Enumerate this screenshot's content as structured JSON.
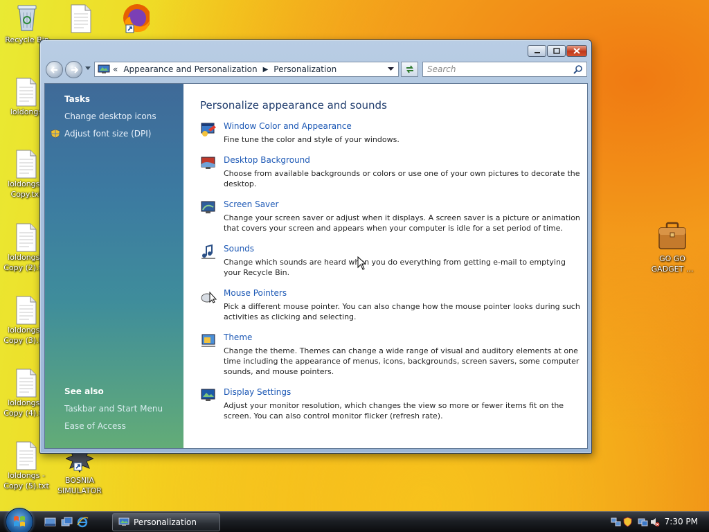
{
  "desktop": {
    "icons": [
      {
        "label": "Recycle Bin"
      },
      {
        "label": ""
      },
      {
        "label": ""
      },
      {
        "label": "loldongs"
      },
      {
        "label": "loldongs -\nCopy.txt"
      },
      {
        "label": "loldongs -\nCopy (2).txt"
      },
      {
        "label": "loldongs -\nCopy (3).txt"
      },
      {
        "label": "loldongs -\nCopy (4).txt"
      },
      {
        "label": "loldongs -\nCopy (5).txt"
      },
      {
        "label": "BOSNIA\nSIMULATOR"
      },
      {
        "label": "GO GO\nGADGET ..."
      }
    ]
  },
  "window": {
    "address": {
      "crumbs": [
        "Appearance and Personalization",
        "Personalization"
      ],
      "overflow_chevron": "«",
      "separator": "▶"
    },
    "search": {
      "placeholder": "Search"
    },
    "sidebar": {
      "tasks_heading": "Tasks",
      "tasks": [
        "Change desktop icons",
        "Adjust font size (DPI)"
      ],
      "see_also_heading": "See also",
      "see_also": [
        "Taskbar and Start Menu",
        "Ease of Access"
      ]
    },
    "main": {
      "title": "Personalize appearance and sounds",
      "items": [
        {
          "title": "Window Color and Appearance",
          "desc": "Fine tune the color and style of your windows.",
          "icon": "window-color-icon"
        },
        {
          "title": "Desktop Background",
          "desc": "Choose from available backgrounds or colors or use one of your own pictures to decorate the desktop.",
          "icon": "desktop-background-icon"
        },
        {
          "title": "Screen Saver",
          "desc": "Change your screen saver or adjust when it displays. A screen saver is a picture or animation that covers your screen and appears when your computer is idle for a set period of time.",
          "icon": "screen-saver-icon"
        },
        {
          "title": "Sounds",
          "desc": "Change which sounds are heard when you do everything from getting e-mail to emptying your Recycle Bin.",
          "icon": "sounds-icon"
        },
        {
          "title": "Mouse Pointers",
          "desc": "Pick a different mouse pointer. You can also change how the mouse pointer looks during such activities as clicking and selecting.",
          "icon": "mouse-pointers-icon"
        },
        {
          "title": "Theme",
          "desc": "Change the theme. Themes can change a wide range of visual and auditory elements at one time including the appearance of menus, icons, backgrounds, screen savers, some computer sounds, and mouse pointers.",
          "icon": "theme-icon"
        },
        {
          "title": "Display Settings",
          "desc": "Adjust your monitor resolution, which changes the view so more or fewer items fit on the screen. You can also control monitor flicker (refresh rate).",
          "icon": "display-settings-icon"
        }
      ]
    }
  },
  "taskbar": {
    "active_task": "Personalization",
    "clock": "7:30 PM"
  },
  "colors": {
    "link": "#1c58b5",
    "title": "#1e3b6c"
  }
}
